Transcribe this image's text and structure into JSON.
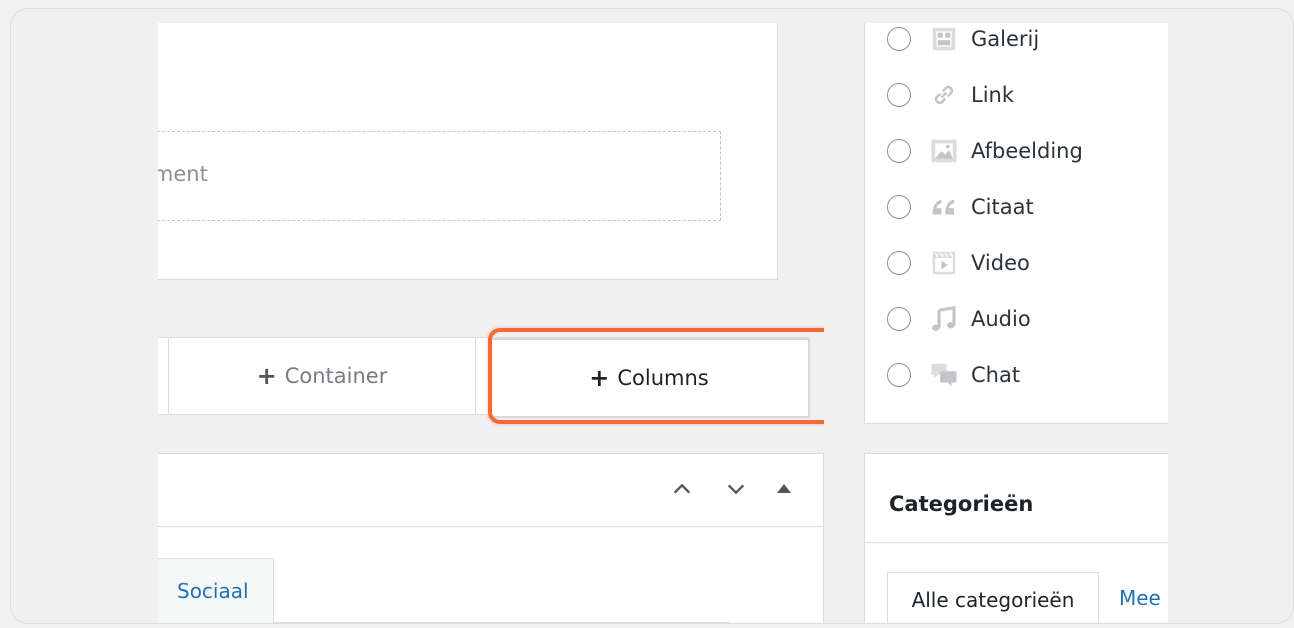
{
  "editor": {
    "placeholder_fragment": "ement"
  },
  "add_buttons": {
    "container_plus": "+",
    "container_label": "Container",
    "columns_plus": "+",
    "columns_label": "Columns"
  },
  "bottom_panel": {
    "tab_label": "Sociaal"
  },
  "format": {
    "items": [
      {
        "label": "Galerij",
        "icon": "gallery-icon"
      },
      {
        "label": "Link",
        "icon": "link-icon"
      },
      {
        "label": "Afbeelding",
        "icon": "image-icon"
      },
      {
        "label": "Citaat",
        "icon": "quote-icon"
      },
      {
        "label": "Video",
        "icon": "video-icon"
      },
      {
        "label": "Audio",
        "icon": "audio-icon"
      },
      {
        "label": "Chat",
        "icon": "chat-icon"
      }
    ]
  },
  "categories": {
    "title": "Categorieën",
    "tab_all": "Alle categorieën",
    "tab_more": "Mee"
  },
  "colors": {
    "highlight": "#f26b35",
    "link": "#2271b1"
  }
}
